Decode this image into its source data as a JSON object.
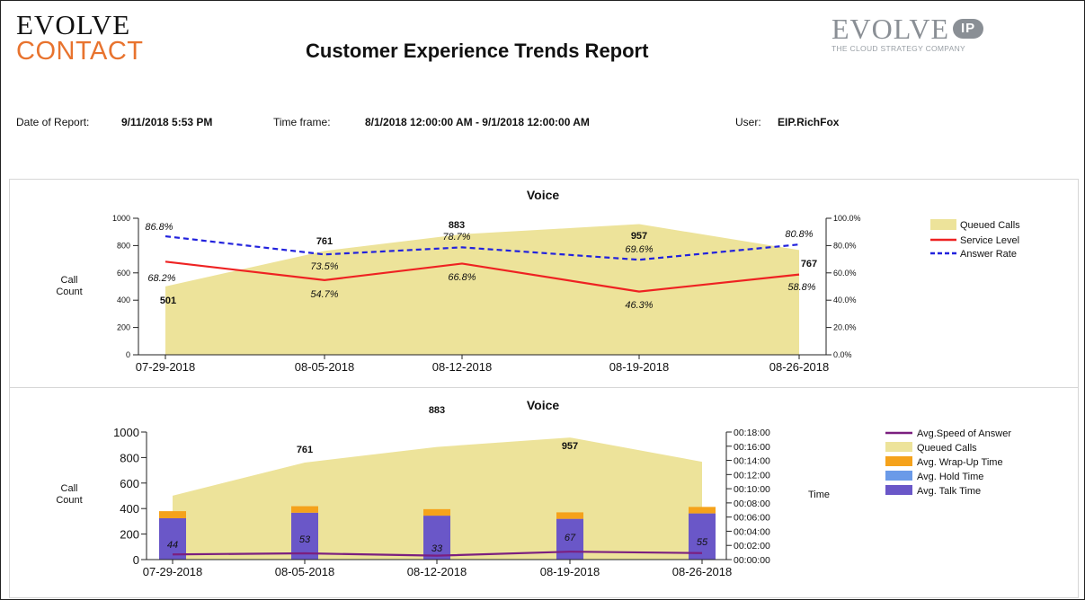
{
  "header": {
    "logo_left_line1": "EVOLVE",
    "logo_left_line2": "CONTACT",
    "title": "Customer Experience Trends Report",
    "logo_right_main": "EVOLVE",
    "logo_right_badge": "IP",
    "logo_right_tagline": "THE CLOUD STRATEGY COMPANY"
  },
  "meta": {
    "date_label": "Date of Report:",
    "date_value": "9/11/2018 5:53 PM",
    "timeframe_label": "Time frame:",
    "timeframe_value": "8/1/2018 12:00:00 AM - 9/1/2018 12:00:00 AM",
    "user_label": "User:",
    "user_value": "EIP.RichFox"
  },
  "chart_data": [
    {
      "type": "area",
      "title": "Voice",
      "ylabel": "Call Count",
      "ylim": [
        0,
        1000
      ],
      "y_ticks": [
        "0",
        "200",
        "400",
        "600",
        "800",
        "1000"
      ],
      "y2lim": [
        0,
        100
      ],
      "y2_ticks": [
        "0.0%",
        "20.0%",
        "40.0%",
        "60.0%",
        "80.0%",
        "100.0%"
      ],
      "categories": [
        "07-29-2018",
        "08-05-2018",
        "08-12-2018",
        "08-19-2018",
        "08-26-2018"
      ],
      "series": [
        {
          "name": "Queued Calls",
          "kind": "area",
          "axis": "left",
          "values": [
            501,
            761,
            883,
            957,
            767
          ],
          "labels": [
            "501",
            "761",
            "883",
            "957",
            "767"
          ],
          "color": "#ede39a"
        },
        {
          "name": "Service Level",
          "kind": "line",
          "axis": "right",
          "values": [
            68.2,
            54.7,
            66.8,
            46.3,
            58.8
          ],
          "labels": [
            "68.2%",
            "54.7%",
            "66.8%",
            "46.3%",
            "58.8%"
          ],
          "color": "#ee2222"
        },
        {
          "name": "Answer Rate",
          "kind": "dashed-line",
          "axis": "right",
          "values": [
            86.8,
            73.5,
            78.7,
            69.6,
            80.8
          ],
          "labels": [
            "86.8%",
            "73.5%",
            "78.7%",
            "69.6%",
            "80.8%"
          ],
          "color": "#2222dd"
        }
      ],
      "legend_position": "right"
    },
    {
      "type": "bar",
      "title": "Voice",
      "ylabel": "Call Count",
      "y2label": "Time",
      "ylim": [
        0,
        1000
      ],
      "y_ticks": [
        "0",
        "200",
        "400",
        "600",
        "800",
        "1000"
      ],
      "y2lim_seconds": [
        0,
        1080
      ],
      "y2_ticks": [
        "00:00:00",
        "00:02:00",
        "00:04:00",
        "00:06:00",
        "00:08:00",
        "00:10:00",
        "00:12:00",
        "00:14:00",
        "00:16:00",
        "00:18:00"
      ],
      "categories": [
        "07-29-2018",
        "08-05-2018",
        "08-12-2018",
        "08-19-2018",
        "08-26-2018"
      ],
      "series": [
        {
          "name": "Avg.Speed of Answer",
          "kind": "line",
          "axis": "right",
          "unit": "seconds",
          "values": [
            44,
            53,
            33,
            67,
            55
          ],
          "labels": [
            "44",
            "53",
            "33",
            "67",
            "55"
          ],
          "color": "#7b1f7f"
        },
        {
          "name": "Queued Calls",
          "kind": "area",
          "axis": "left",
          "values": [
            501,
            761,
            883,
            957,
            767
          ],
          "labels": [
            "",
            "761",
            "883",
            "957",
            ""
          ],
          "color": "#ede39a"
        },
        {
          "name": "Avg. Wrap-Up Time",
          "kind": "stacked-bar",
          "axis": "right",
          "unit": "seconds",
          "values": [
            60,
            55,
            55,
            55,
            55
          ],
          "color": "#f5a21b"
        },
        {
          "name": "Avg. Hold Time",
          "kind": "stacked-bar",
          "axis": "right",
          "unit": "seconds",
          "values": [
            0,
            0,
            0,
            0,
            0
          ],
          "color": "#6a9ae8"
        },
        {
          "name": "Avg. Talk Time",
          "kind": "stacked-bar",
          "axis": "right",
          "unit": "seconds",
          "values": [
            350,
            397,
            372,
            345,
            391
          ],
          "color": "#6a57c8"
        }
      ],
      "legend_position": "right"
    }
  ]
}
